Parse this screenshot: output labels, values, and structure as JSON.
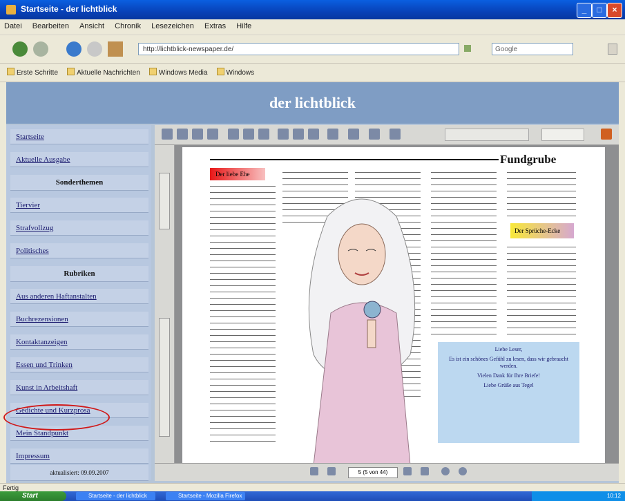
{
  "window": {
    "title": "Startseite - der lichtblick"
  },
  "menu": {
    "items": [
      "Datei",
      "Bearbeiten",
      "Ansicht",
      "Chronik",
      "Lesezeichen",
      "Extras",
      "Hilfe"
    ]
  },
  "nav": {
    "address": "http://lichtblick-newspaper.de/",
    "search_placeholder": "Google"
  },
  "bookmarks": [
    "Erste Schritte",
    "Aktuelle Nachrichten",
    "Windows Media",
    "Windows"
  ],
  "site": {
    "title": "der lichtblick"
  },
  "sidebar": {
    "items": [
      {
        "kind": "link",
        "label": "Startseite"
      },
      {
        "kind": "link",
        "label": "Aktuelle Ausgabe"
      },
      {
        "kind": "head",
        "label": "Sonderthemen"
      },
      {
        "kind": "link",
        "label": "Tiervier"
      },
      {
        "kind": "link",
        "label": "Strafvollzug"
      },
      {
        "kind": "link",
        "label": "Politisches"
      },
      {
        "kind": "head",
        "label": "Rubriken"
      },
      {
        "kind": "link",
        "label": "Aus anderen Haftanstalten"
      },
      {
        "kind": "link",
        "label": "Buchrezensionen"
      },
      {
        "kind": "link",
        "label": "Kontaktanzeigen"
      },
      {
        "kind": "link",
        "label": "Essen und Trinken"
      },
      {
        "kind": "link",
        "label": "Kunst in Arbeitshaft"
      },
      {
        "kind": "link",
        "label": "Gedichte und Kurzprosa"
      },
      {
        "kind": "link",
        "label": "Mein Standpunkt"
      },
      {
        "kind": "link",
        "label": "Impressum"
      },
      {
        "kind": "text",
        "label": "aktualisiert: 09.09.2007"
      }
    ]
  },
  "newspaper": {
    "heading": "Fundgrube",
    "tag1": "Der liebe Ehe",
    "tag2": "Der Sprüche-Ecke",
    "bluebox": [
      "Liebe Leser,",
      "Es ist ein schönes Gefühl zu lesen, dass wir gebraucht werden.",
      "Vielen Dank für Ihre Briefe!",
      "Liebe Grüße aus Tegel"
    ]
  },
  "viewer": {
    "page_field": "5 (5 von 44)"
  },
  "statusbar": {
    "text": "Fertig"
  },
  "taskbar": {
    "start": "Start",
    "tasks": [
      "Startseite - der lichtblick",
      "Startseite - Mozilla Firefox"
    ],
    "clock": "10:12"
  }
}
